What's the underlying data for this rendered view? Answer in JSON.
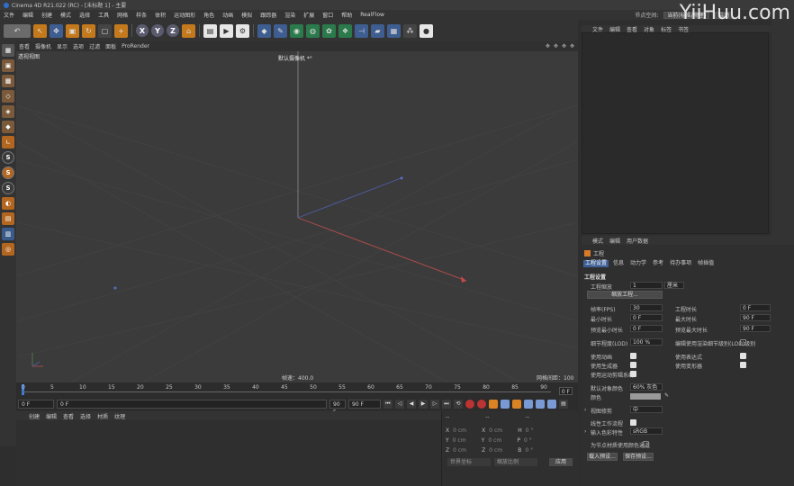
{
  "window": {
    "title": "Cinema 4D R21.022 (RC) - [未标题 1] - 主要"
  },
  "menubar": {
    "items": [
      "文件",
      "编辑",
      "创建",
      "模式",
      "选择",
      "工具",
      "网格",
      "样条",
      "体积",
      "运动图形",
      "角色",
      "动画",
      "模拟",
      "跟踪器",
      "渲染",
      "扩展",
      "窗口",
      "帮助",
      "RealFlow"
    ],
    "node_space_label": "节点空间:",
    "node_space_value": "当前(标准/物理)",
    "interface_value": "启动"
  },
  "watermark": "YiiHuu.com",
  "toolbar": {
    "axis_x": "X",
    "axis_y": "Y",
    "axis_z": "Z",
    "icons": [
      "undo-icon",
      "live-select-icon",
      "move-icon",
      "scale-icon",
      "rotate-icon",
      "add-icon",
      "coord-system-icon",
      "render-view-icon",
      "render-picture-icon",
      "render-settings-icon",
      "cube-icon",
      "pen-icon",
      "subdivision-icon",
      "array-icon",
      "generator-icon",
      "deformer-icon",
      "field-icon",
      "light-icon",
      "camera-icon",
      "scene-icon",
      "bulb-icon"
    ]
  },
  "viewport": {
    "menu": [
      "查看",
      "摄像机",
      "显示",
      "选项",
      "过滤",
      "面板",
      "ProRender"
    ],
    "view_name": "透视视图",
    "camera": "默认摄像机 *°",
    "speed": "帧速：400.0",
    "grid_spacing": "网格间距：100 cm"
  },
  "timeline": {
    "ticks": [
      "0",
      "5",
      "10",
      "15",
      "20",
      "25",
      "30",
      "35",
      "40",
      "45",
      "50",
      "55",
      "60",
      "65",
      "70",
      "75",
      "80",
      "85",
      "90"
    ],
    "current_frame": "0 F"
  },
  "transport": {
    "start": "0 F",
    "current": "0 F",
    "end": "90 F",
    "end2": "90 F"
  },
  "materials": {
    "menu": [
      "创建",
      "编辑",
      "查看",
      "选择",
      "材质",
      "纹理"
    ]
  },
  "coords": {
    "header_dashes": [
      "--",
      "--",
      "--"
    ],
    "rows": [
      {
        "a": "X",
        "av": "0 cm",
        "b": "X",
        "bv": "0 cm",
        "c": "H",
        "cv": "0 °"
      },
      {
        "a": "Y",
        "av": "0 cm",
        "b": "Y",
        "bv": "0 cm",
        "c": "P",
        "cv": "0 °"
      },
      {
        "a": "Z",
        "av": "0 cm",
        "b": "Z",
        "bv": "0 cm",
        "c": "B",
        "cv": "0 °"
      }
    ],
    "dropdown1": "世界坐标",
    "dropdown2": "缩放比例",
    "apply": "应用"
  },
  "object_manager": {
    "menu": [
      "文件",
      "编辑",
      "查看",
      "对象",
      "标签",
      "书签"
    ]
  },
  "attributes": {
    "menu": [
      "模式",
      "编辑",
      "用户数据"
    ],
    "title": "工程",
    "tabs": [
      "工程设置",
      "信息",
      "动力学",
      "参考",
      "待办事项",
      "帧插值"
    ],
    "active_tab": 0,
    "section": "工程设置",
    "scale_label": "工程缩放",
    "scale_value": "1",
    "scale_unit": "厘米",
    "scale_button": "缩放工程...",
    "fps_label": "帧率(FPS)",
    "fps_value": "30",
    "project_time_label": "工程时长",
    "project_time_value": "0 F",
    "min_time_label": "最小时长",
    "min_time_value": "0 F",
    "max_time_label": "最大时长",
    "max_time_value": "90 F",
    "preview_min_label": "预览最小时长",
    "preview_min_value": "0 F",
    "preview_max_label": "预览最大时长",
    "preview_max_value": "90 F",
    "lod_label": "细节程度(LOD)",
    "lod_value": "100 %",
    "render_lod_label": "编辑使用渲染细节级别(LOD)级别",
    "use_anim_label": "使用动画",
    "use_expr_label": "使用表达式",
    "use_gen_label": "使用生成器",
    "use_deform_label": "使用变形器",
    "use_motion_label": "使用运动剪辑系统",
    "default_color_label": "默认对象颜色",
    "default_color_value": "60% 灰色",
    "color_label": "颜色",
    "view_clip_label": "视图修剪",
    "view_clip_value": "中",
    "linear_label": "线性工作流程",
    "input_color_label": "输入色彩特性",
    "input_color_value": "sRGB",
    "vertex_color_label": "为节点材质使用颜色通道",
    "load_preset": "载入预设...",
    "save_preset": "保存预设..."
  }
}
